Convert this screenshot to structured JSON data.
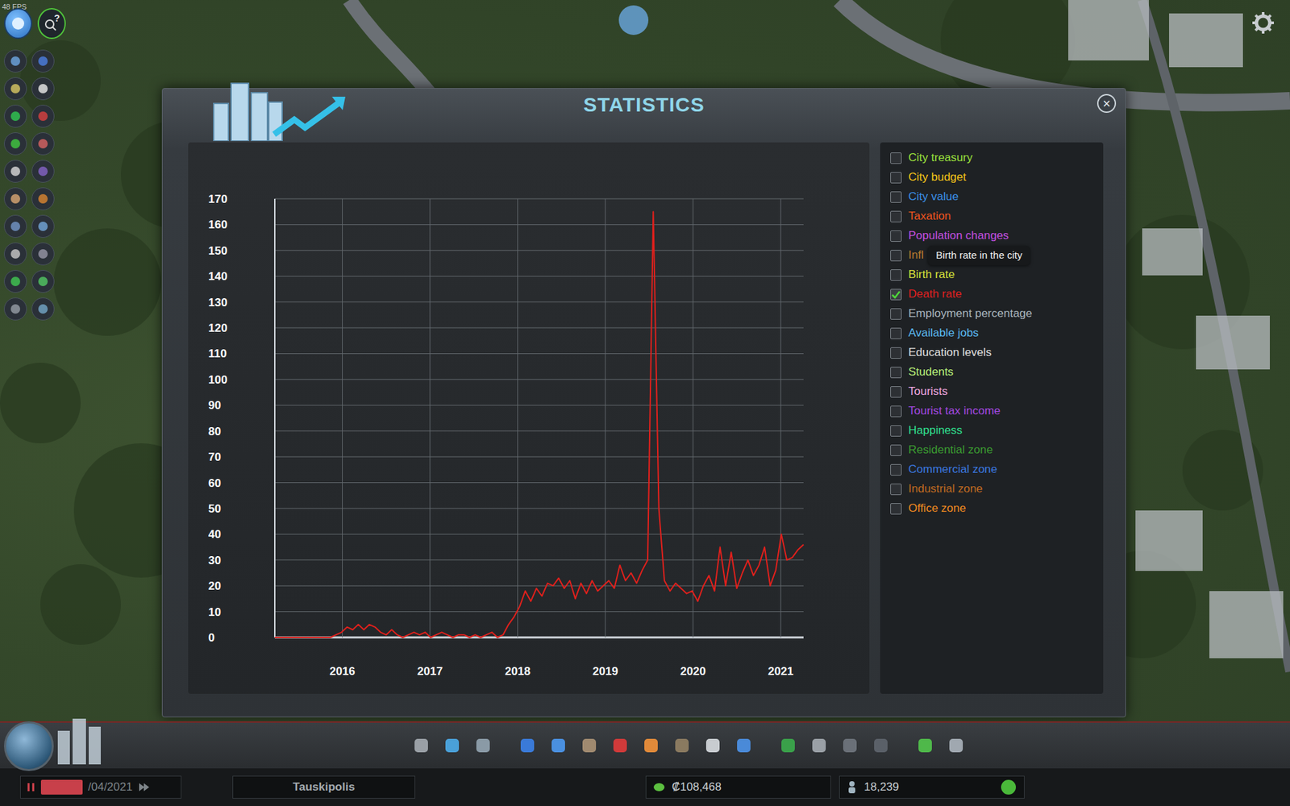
{
  "fps": "48 FPS",
  "search_button": {
    "glyph": "?"
  },
  "window": {
    "title": "STATISTICS",
    "close": "×"
  },
  "chart": {
    "y_ticks": [
      "170",
      "160",
      "150",
      "140",
      "130",
      "120",
      "110",
      "100",
      "90",
      "80",
      "70",
      "60",
      "50",
      "40",
      "30",
      "20",
      "10",
      "0"
    ],
    "x_ticks": [
      "2016",
      "2017",
      "2018",
      "2019",
      "2020",
      "2021"
    ],
    "series": [
      {
        "color": "#e0201c",
        "values": [
          0,
          0,
          0,
          0,
          0,
          0,
          0,
          0,
          0,
          0,
          0,
          1,
          2,
          4,
          3,
          5,
          3,
          5,
          4,
          2,
          1,
          3,
          1,
          0,
          1,
          2,
          1,
          2,
          0,
          1,
          2,
          1,
          0,
          1,
          1,
          0,
          1,
          0,
          1,
          2,
          0,
          1,
          5,
          8,
          12,
          18,
          14,
          19,
          16,
          21,
          20,
          23,
          19,
          22,
          15,
          21,
          17,
          22,
          18,
          20,
          22,
          19,
          28,
          22,
          25,
          21,
          26,
          30,
          165,
          50,
          22,
          18,
          21,
          19,
          17,
          18,
          14,
          20,
          24,
          18,
          35,
          20,
          33,
          19,
          25,
          30,
          24,
          28,
          35,
          20,
          26,
          40,
          30,
          31,
          34,
          36
        ]
      }
    ]
  },
  "legend": [
    {
      "label": "City treasury",
      "checked": false,
      "color": "#9be03c"
    },
    {
      "label": "City budget",
      "checked": false,
      "color": "#f5c518"
    },
    {
      "label": "City value",
      "checked": false,
      "color": "#3a8fe8"
    },
    {
      "label": "Taxation",
      "checked": false,
      "color": "#f0541e"
    },
    {
      "label": "Population changes",
      "checked": false,
      "color": "#c44fe0"
    },
    {
      "label": "Infl",
      "checked": false,
      "color": "#b87a2e"
    },
    {
      "label": "Birth rate",
      "checked": false,
      "color": "#d5e03a"
    },
    {
      "label": "Death rate",
      "checked": true,
      "color": "#e02020"
    },
    {
      "label": "Employment percentage",
      "checked": false,
      "color": "#a8b4bc"
    },
    {
      "label": "Available jobs",
      "checked": false,
      "color": "#5ab8f0"
    },
    {
      "label": "Education levels",
      "checked": false,
      "color": "#e0e0e0"
    },
    {
      "label": "Students",
      "checked": false,
      "color": "#b8f07a"
    },
    {
      "label": "Tourists",
      "checked": false,
      "color": "#f0a8e0"
    },
    {
      "label": "Tourist tax income",
      "checked": false,
      "color": "#a448e0"
    },
    {
      "label": "Happiness",
      "checked": false,
      "color": "#30e090"
    },
    {
      "label": "Residential zone",
      "checked": false,
      "color": "#3a9a30"
    },
    {
      "label": "Commercial zone",
      "checked": false,
      "color": "#3a78e0"
    },
    {
      "label": "Industrial zone",
      "checked": false,
      "color": "#c06a20"
    },
    {
      "label": "Office zone",
      "checked": false,
      "color": "#f08a20"
    }
  ],
  "tooltip": {
    "text": "Birth rate in the city"
  },
  "bottom_bar": {
    "date": "/04/2021",
    "city_name": "Tauskipolis",
    "money": "₡108,468",
    "population": "18,239"
  }
}
